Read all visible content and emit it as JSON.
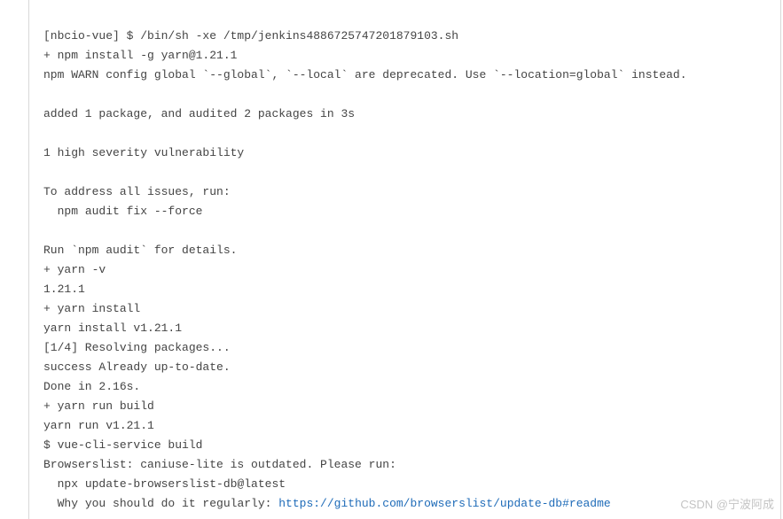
{
  "log": {
    "lines": [
      "[nbcio-vue] $ /bin/sh -xe /tmp/jenkins4886725747201879103.sh",
      "+ npm install -g yarn@1.21.1",
      "npm WARN config global `--global`, `--local` are deprecated. Use `--location=global` instead.",
      "",
      "added 1 package, and audited 2 packages in 3s",
      "",
      "1 high severity vulnerability",
      "",
      "To address all issues, run:",
      "  npm audit fix --force",
      "",
      "Run `npm audit` for details.",
      "+ yarn -v",
      "1.21.1",
      "+ yarn install",
      "yarn install v1.21.1",
      "[1/4] Resolving packages...",
      "success Already up-to-date.",
      "Done in 2.16s.",
      "+ yarn run build",
      "yarn run v1.21.1",
      "$ vue-cli-service build",
      "Browserslist: caniuse-lite is outdated. Please run:",
      "  npx update-browserslist-db@latest"
    ],
    "link_prefix": "  Why you should do it regularly: ",
    "link_url": "https://github.com/browserslist/update-db#readme"
  },
  "watermark": "CSDN @宁波阿成"
}
